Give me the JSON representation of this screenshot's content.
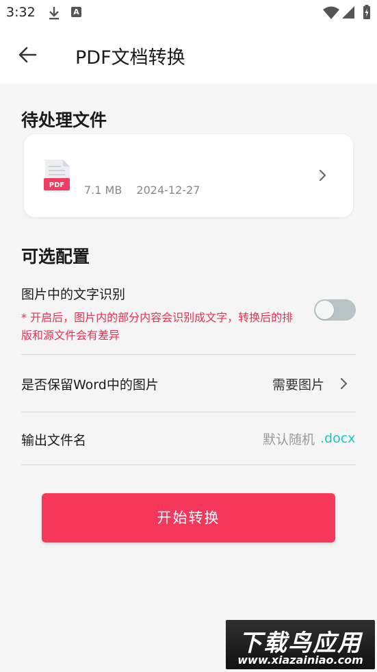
{
  "status_bar": {
    "time": "3:32",
    "icons": [
      "download-icon",
      "a-icon",
      "wifi-icon",
      "signal-icon",
      "battery-icon"
    ],
    "a_glyph": "A"
  },
  "app_bar": {
    "title": "PDF文档转换",
    "back_icon": "back-arrow-icon"
  },
  "pending_section": {
    "title": "待处理文件",
    "file": {
      "icon": "pdf-file-icon",
      "icon_label": "PDF",
      "size": "7.1 MB",
      "date": "2024-12-27"
    }
  },
  "options_section": {
    "title": "可选配置",
    "ocr": {
      "label": "图片中的文字识别",
      "note": "* 开启后，图片内的部分内容会识别成文字，转换后的排版和源文件会有差异",
      "enabled": false
    },
    "keep_images": {
      "label": "是否保留Word中的图片",
      "value": "需要图片"
    },
    "output_name": {
      "label": "输出文件名",
      "placeholder": "默认随机",
      "value": "",
      "extension": ".docx"
    }
  },
  "start_button": {
    "label": "开始转换"
  },
  "watermark": {
    "title": "下载鸟应用",
    "url": "www.xiazainiao.com"
  },
  "colors": {
    "accent": "#f5375b",
    "note_red": "#e8304f",
    "extension_teal": "#18c7c0",
    "background": "#f5f5f5"
  }
}
